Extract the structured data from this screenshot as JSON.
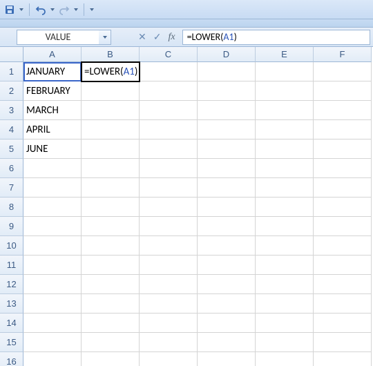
{
  "qat": {
    "save_icon": "save-icon",
    "undo_icon": "undo-icon",
    "redo_icon": "redo-icon"
  },
  "name_box": {
    "value": "VALUE"
  },
  "formula_bar": {
    "cancel": "✕",
    "enter": "✓",
    "fx": "fx",
    "formula_prefix": "=LOWER(",
    "formula_ref": "A1",
    "formula_suffix": ")"
  },
  "columns": [
    "A",
    "B",
    "C",
    "D",
    "E",
    "F"
  ],
  "rows": [
    "1",
    "2",
    "3",
    "4",
    "5",
    "6",
    "7",
    "8",
    "9",
    "10",
    "11",
    "12",
    "13",
    "14",
    "15",
    "16"
  ],
  "cells": {
    "A1": "JANUARY",
    "A2": "FEBRUARY",
    "A3": "MARCH",
    "A4": "APRIL",
    "A5": "JUNE"
  },
  "editing_cell": "B1",
  "editing_formula_prefix": "=LOWER(",
  "editing_formula_ref": "A1",
  "editing_formula_suffix": ")",
  "referenced_cell": "A1",
  "colors": {
    "ref_color": "#2a53b8"
  }
}
